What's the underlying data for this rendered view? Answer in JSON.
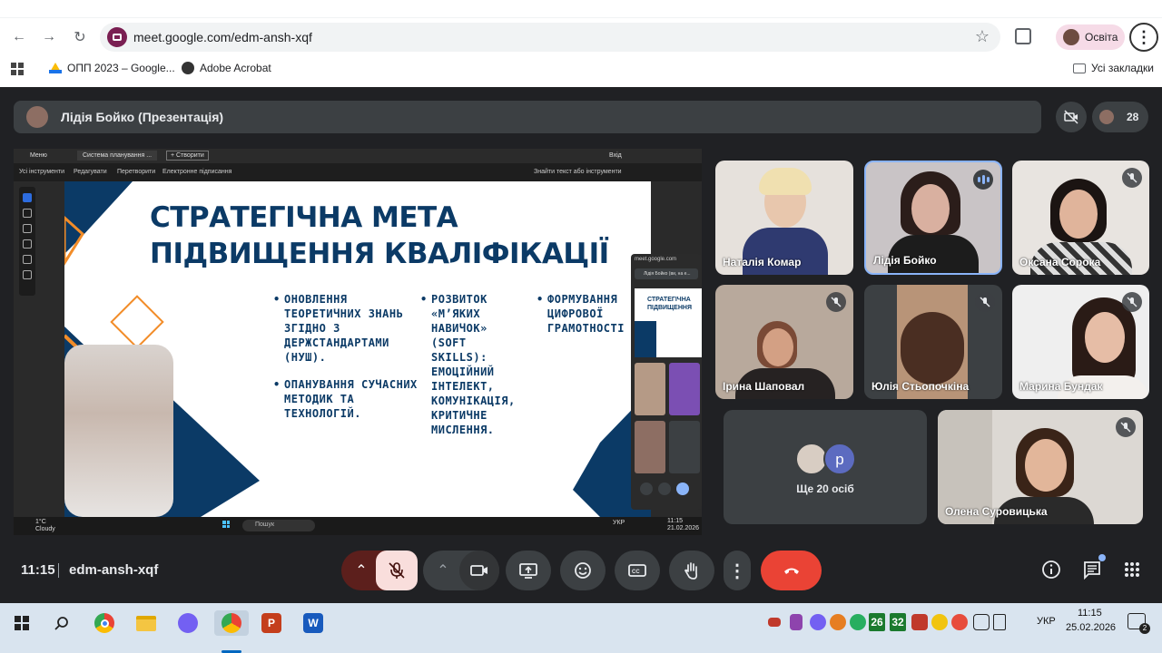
{
  "browser": {
    "url": "meet.google.com/edm-ansh-xqf",
    "profile_label": "Освіта",
    "bookmarks": [
      "ОПП 2023 – Google...",
      "Adobe Acrobat"
    ],
    "all_bookmarks": "Усі закладки"
  },
  "meet": {
    "presenter_title": "Лідія Бойко (Презентація)",
    "participant_count": "28",
    "time": "11:15",
    "meeting_code": "edm-ansh-xqf",
    "more_people_label": "Ще 20 осіб",
    "more_people_initial": "p",
    "participants": [
      {
        "name": "Наталія Комар",
        "muted": false
      },
      {
        "name": "Лідія Бойко",
        "muted": false,
        "speaking": true
      },
      {
        "name": "Оксана Сорока",
        "muted": true
      },
      {
        "name": "Ірина Шаповал",
        "muted": true
      },
      {
        "name": "Юлія Стьопочкіна",
        "muted": true
      },
      {
        "name": "Марина Бундак",
        "muted": true
      },
      {
        "name": "Олена Суровицька",
        "muted": true
      }
    ]
  },
  "shared_screen": {
    "tabs": [
      "Меню",
      "Система планування ...",
      "+ Створити",
      "Вхід"
    ],
    "toolbar": [
      "Усі інструменти",
      "Редагувати",
      "Перетворити",
      "Електронне підписання",
      "Знайти текст або інструменти"
    ],
    "slide": {
      "title_line1": "СТРАТЕГІЧНА МЕТА",
      "title_line2": "ПІДВИЩЕННЯ КВАЛІФІКАЦІЇ",
      "col1": [
        "ОНОВЛЕННЯ ТЕОРЕТИЧНИХ ЗНАНЬ ЗГІДНО З ДЕРЖСТАНДАРТАМИ (НУШ).",
        "ОПАНУВАННЯ СУЧАСНИХ МЕТОДИК ТА ТЕХНОЛОГІЙ."
      ],
      "col2": [
        "РОЗВИТОК «М’ЯКИХ НАВИЧОК» (SOFT SKILLS): ЕМОЦІЙНИЙ ІНТЕЛЕКТ, КОМУНІКАЦІЯ, КРИТИЧНЕ МИСЛЕННЯ."
      ],
      "col3": [
        "ФОРМУВАННЯ ЦИФРОВОЇ ГРАМОТНОСТІ"
      ]
    },
    "mini_meet": {
      "url": "meet.google.com",
      "title": "Лідія Бойко (ви, на е...",
      "slide_title": "СТРАТЕГІЧНА ПІДВИЩЕННЯ"
    },
    "taskbar": {
      "weather_temp": "1°C",
      "weather_desc": "Cloudy",
      "search": "Пошук",
      "lang": "УКР",
      "time": "11:15",
      "date": "21.02.2026"
    }
  },
  "taskbar": {
    "badge1": "26",
    "badge2": "32",
    "lang": "УКР",
    "time": "11:15",
    "date": "25.02.2026",
    "notifications": "2"
  },
  "colors": {
    "meet_bg": "#202124",
    "end_call": "#ea4335",
    "mic_off": "#f9dedc",
    "slide_navy": "#0b3a66",
    "slide_orange": "#f28c28"
  }
}
